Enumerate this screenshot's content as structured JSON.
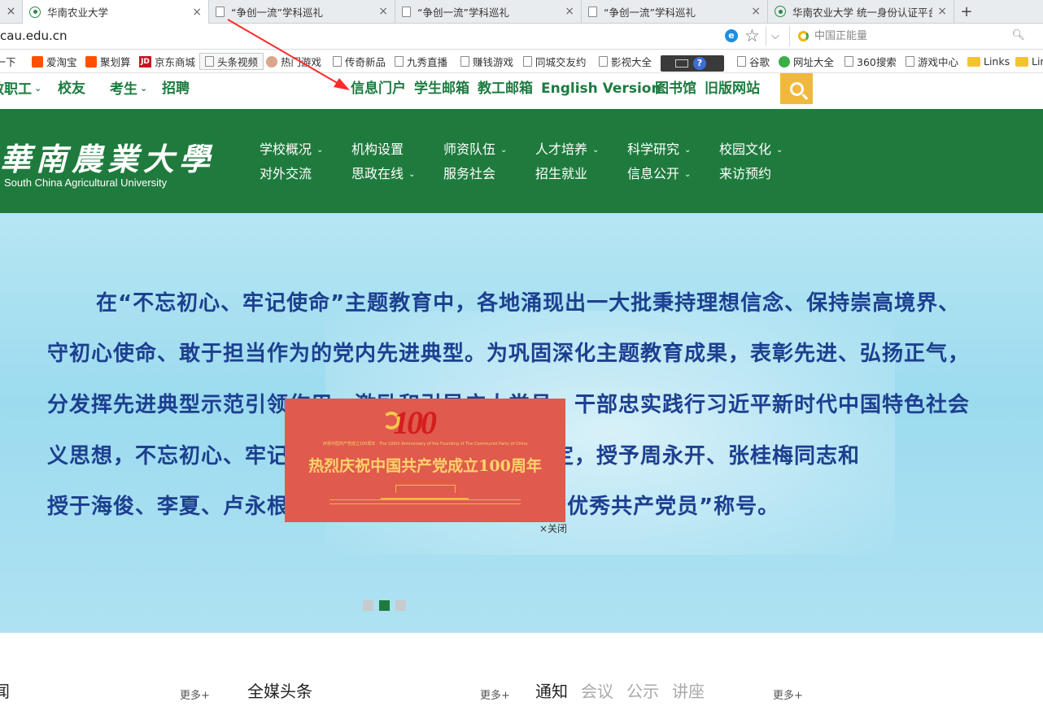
{
  "browser": {
    "tabs": [
      {
        "title": "华南农业大学",
        "active": true,
        "icon": "university-logo-icon"
      },
      {
        "title": "“争创一流”学科巡礼",
        "active": false,
        "icon": "page-icon"
      },
      {
        "title": "“争创一流”学科巡礼",
        "active": false,
        "icon": "page-icon"
      },
      {
        "title": "“争创一流”学科巡礼",
        "active": false,
        "icon": "page-icon"
      },
      {
        "title": "华南农业大学 统一身份认证平台",
        "active": false,
        "icon": "university-logo-icon"
      }
    ],
    "first_tab_close": "×",
    "tab_close": "×",
    "new_tab": "+",
    "url": "cau.edu.cn",
    "ie_mode": "e",
    "search_placeholder": "中国正能量",
    "bookmarks": [
      "搜一下",
      "爱淘宝",
      "聚划算",
      "京东商城",
      "头条视频",
      "热门游戏",
      "传奇新品",
      "九秀直播",
      "赚钱游戏",
      "同城交友约",
      "影视大全",
      "谷歌",
      "网址大全",
      "360搜索",
      "游戏中心",
      "Links",
      "Links"
    ],
    "ime_help": "?"
  },
  "site": {
    "top_nav_left": [
      {
        "label": "教职工",
        "dropdown": true
      },
      {
        "label": "校友",
        "dropdown": false
      },
      {
        "label": "考生",
        "dropdown": true
      },
      {
        "label": "招聘",
        "dropdown": false
      }
    ],
    "top_nav_right": [
      "信息门户",
      "学生邮箱",
      "教工邮箱",
      "English Version",
      "图书馆",
      "旧版网站"
    ],
    "logo_cn": "華南農業大學",
    "logo_en": "South China Agricultural University",
    "main_menu": [
      {
        "label": "学校概况",
        "dropdown": true
      },
      {
        "label": "机构设置",
        "dropdown": false
      },
      {
        "label": "师资队伍",
        "dropdown": true
      },
      {
        "label": "人才培养",
        "dropdown": true
      },
      {
        "label": "科学研究",
        "dropdown": true
      },
      {
        "label": "校园文化",
        "dropdown": true
      },
      {
        "label": "对外交流",
        "dropdown": false
      },
      {
        "label": "思政在线",
        "dropdown": true
      },
      {
        "label": "服务社会",
        "dropdown": false
      },
      {
        "label": "招生就业",
        "dropdown": false
      },
      {
        "label": "信息公开",
        "dropdown": true
      },
      {
        "label": "来访预约",
        "dropdown": false
      }
    ],
    "banner_lines": [
      "在“不忘初心、牢记使命”主题教育中，各地涌现出一大批秉持理想信念、保持崇高境界、",
      "守初心使命、敢于担当作为的党内先进典型。为巩固深化主题教育成果，表彰先进、弘扬正气，",
      "分发挥先进典型示范引领作用，激励和引导广大党员、干部忠实践行习近平新时代中国特色社会",
      "义思想，不忘初心、牢记使命，团结奋进，党中央决定，授予周永开、张桂梅同志和",
      "授于海俊、李夏、卢永根、吴龙、艾合苏提同志“全国优秀共产党员”称号。"
    ],
    "carousel": {
      "count": 3,
      "active": 1
    },
    "popup": {
      "hundred": "100",
      "subtitle": "庆祝中国共产党成立100周年 · The 100th Anniversary of the Founding of The Communist Party of China",
      "headline": "热烈庆祝中国共产党成立100周年",
      "close": "×关闭"
    },
    "news_headers": [
      {
        "label": "闻",
        "active": true
      },
      {
        "label": "全媒头条",
        "active": true
      },
      {
        "label": "通知",
        "active": true
      },
      {
        "label": "会议",
        "active": false
      },
      {
        "label": "公示",
        "active": false
      },
      {
        "label": "讲座",
        "active": false
      }
    ],
    "more_label": "更多+"
  }
}
